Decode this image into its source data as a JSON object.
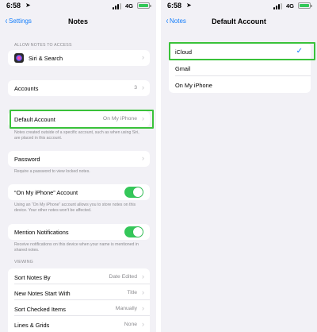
{
  "left": {
    "status": {
      "time": "6:58",
      "network": "4G"
    },
    "nav": {
      "back_label": "Settings",
      "title": "Notes"
    },
    "allow_access_header": "ALLOW NOTES TO ACCESS",
    "siri_search_label": "Siri & Search",
    "accounts": {
      "label": "Accounts",
      "value": "3"
    },
    "default_account": {
      "label": "Default Account",
      "value": "On My iPhone"
    },
    "default_account_footnote": "Notes created outside of a specific account, such as when using Siri, are placed in this account.",
    "password_label": "Password",
    "password_footnote": "Require a password to view locked notes.",
    "on_my_iphone_account": {
      "label": "“On My iPhone” Account",
      "enabled": true
    },
    "on_my_iphone_footnote": "Using an “On My iPhone” account allows you to store notes on this device. Your other notes won't be affected.",
    "mention_notifications": {
      "label": "Mention Notifications",
      "enabled": true
    },
    "mention_footnote": "Receive notifications on this device when your name is mentioned in shared notes.",
    "viewing_header": "VIEWING",
    "viewing_rows": [
      {
        "label": "Sort Notes By",
        "value": "Date Edited"
      },
      {
        "label": "New Notes Start With",
        "value": "Title"
      },
      {
        "label": "Sort Checked Items",
        "value": "Manually"
      },
      {
        "label": "Lines & Grids",
        "value": "None"
      }
    ]
  },
  "right": {
    "status": {
      "time": "6:58",
      "network": "4G"
    },
    "nav": {
      "back_label": "Notes",
      "title": "Default Account"
    },
    "options": [
      {
        "label": "iCloud",
        "selected": true
      },
      {
        "label": "Gmail",
        "selected": false
      },
      {
        "label": "On My iPhone",
        "selected": false
      }
    ]
  },
  "colors": {
    "accent": "#157efb",
    "toggle_on": "#34c759",
    "highlight": "#3ac23a",
    "background": "#f2f1f6"
  }
}
